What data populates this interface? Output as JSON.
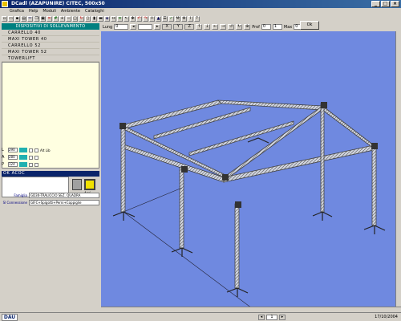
{
  "window": {
    "title": "DCadl (AZAPUNIRE) CITEC, 500x50"
  },
  "menu": [
    "Grafica",
    "Help",
    "Moduli",
    "Ambiente",
    "Cataloghi"
  ],
  "coordbar": {
    "lung_label": "Lung",
    "lung_value": "0",
    "prof_label": "Prof",
    "prof_value": "0",
    "prof2_value": "1",
    "max_label": "Max",
    "max_value": "0",
    "ok_label": "Ok"
  },
  "left_panel": {
    "list_header": "DISPOSITIVI DI SOLLEVAMENTO",
    "list_items": [
      "CARRELLO 40",
      "MAXI TOWER 40",
      "CARRELLO 52",
      "MAXI TOWER 52",
      "TOWERLIFT"
    ],
    "dims": [
      {
        "label": "L",
        "value": "290",
        "opt": "Alt Lib"
      },
      {
        "label": "A",
        "value": "280",
        "opt": ""
      },
      {
        "label": "P",
        "value": "124",
        "opt": ""
      }
    ],
    "selected_item": "OK  ACOC",
    "apri_label": "Apri",
    "famiglia_label": "Famiglia",
    "famiglia_value": "GD30-TRALICCIO SEZ. QUADRA",
    "connessione_label": "Sl Connessione",
    "connessione_value": "GIFC+Spigotti+Perni+Coppiglie"
  },
  "statusbar": {
    "logo": "DAU",
    "page_number": "1",
    "date": "17/10/2004"
  },
  "canvas_color": "#6f89e0"
}
